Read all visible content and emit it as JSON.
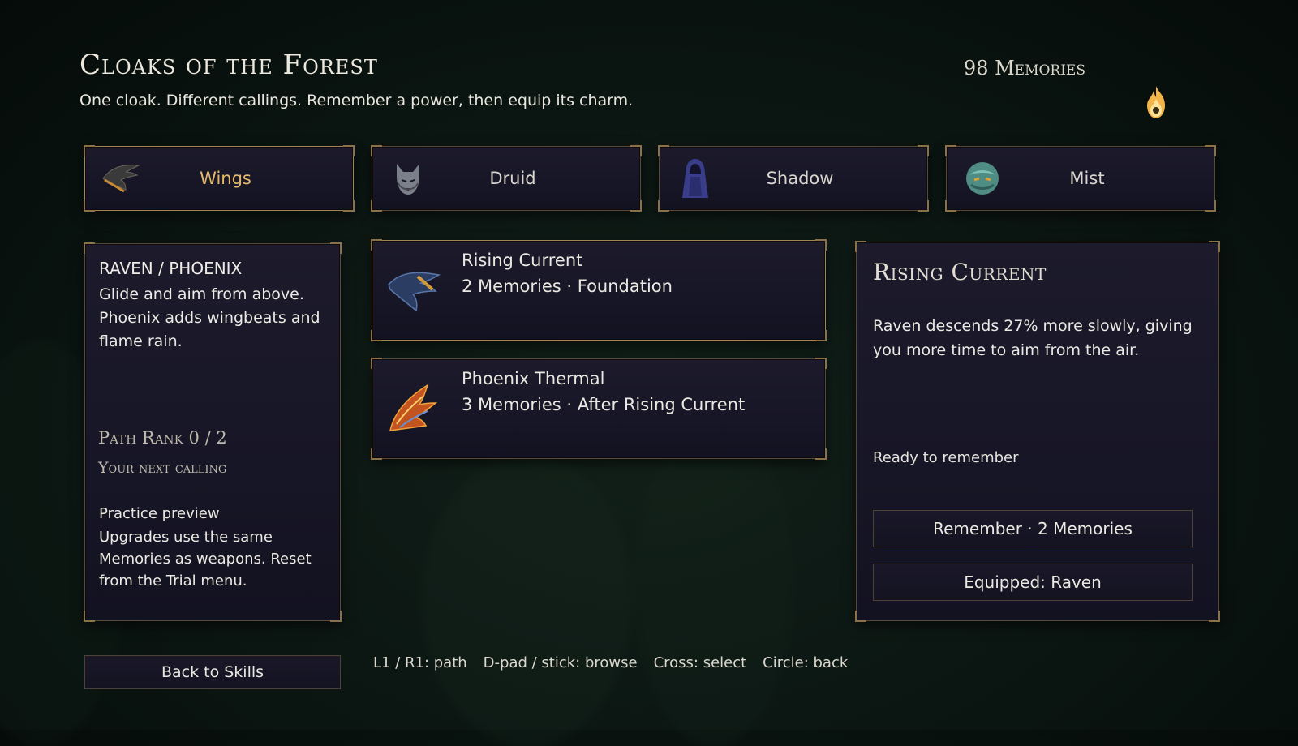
{
  "header": {
    "title": "Cloaks of the Forest",
    "subtitle": "One cloak. Different callings. Remember a power, then equip its charm.",
    "memories": "98 Memories",
    "currency_icon": "flame-icon"
  },
  "tabs": [
    {
      "label": "Wings",
      "icon": "wing-icon",
      "selected": true
    },
    {
      "label": "Druid",
      "icon": "wolf-icon",
      "selected": false
    },
    {
      "label": "Shadow",
      "icon": "hooded-figure-icon",
      "selected": false
    },
    {
      "label": "Mist",
      "icon": "mist-spirit-icon",
      "selected": false
    }
  ],
  "path_panel": {
    "title": "RAVEN / PHOENIX",
    "description": "Glide and aim from above. Phoenix adds wingbeats and flame rain.",
    "practice_title": "Practice preview",
    "practice_body": "Upgrades use the same Memories as weapons. Reset from the Trial menu.",
    "rank": "Path Rank  0 / 2",
    "next": "Your next calling"
  },
  "skills": [
    {
      "name": "Rising Current",
      "meta": "2 Memories · Foundation",
      "icon": "raven-wing-icon"
    },
    {
      "name": "Phoenix Thermal",
      "meta": "3 Memories · After Rising Current",
      "icon": "phoenix-wing-icon"
    }
  ],
  "detail": {
    "title": "Rising Current",
    "body": "Raven descends 27% more slowly, giving you more time to aim from the air.",
    "status": "Ready to remember",
    "remember_label": "Remember · 2 Memories",
    "equipped_label": "Equipped: Raven"
  },
  "footer": {
    "back_label": "Back to Skills",
    "hints": [
      "L1 / R1: path",
      "D-pad / stick: browse",
      "Cross: select",
      "Circle: back"
    ]
  },
  "colors": {
    "accent_gold": "#e8b968",
    "panel_border": "#8c7048",
    "panel_bg": "#181727"
  }
}
